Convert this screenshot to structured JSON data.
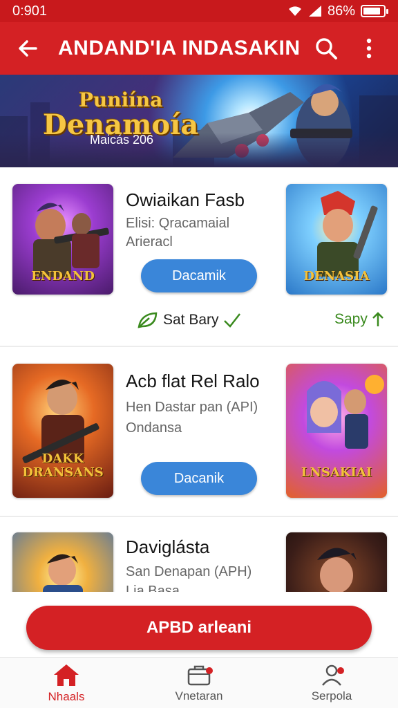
{
  "status_bar": {
    "time": "0:901",
    "battery": "86%",
    "battery_level": 0.86
  },
  "app_bar": {
    "title": "ANDAND'IA INDASAKIN",
    "back_icon": "arrow-left-icon",
    "search_icon": "search-icon",
    "more_icon": "more-vertical-icon"
  },
  "banner": {
    "title_top": "Puniína",
    "title_main": "Denamoía",
    "subtitle": "Maicás 206"
  },
  "games": [
    {
      "title": "Owiaikan Fasb",
      "line1": "Elisi: Qracamaial",
      "line2": "Arieracl",
      "button": "Dacamik",
      "left_caption": "ENDAND",
      "right_caption": "DENASIA"
    },
    {
      "title": "Acb flat Rel Ralo",
      "line1": "Hen Dastar pan (API)",
      "line2": "Ondansa",
      "button": "Dacanik",
      "left_caption": "DAKK DRANSANS",
      "right_caption": "LNSAKIAI"
    },
    {
      "title": "Daviglásta",
      "line1": "San Denapan (APH)",
      "line2": "Lia Basa",
      "left_caption": "",
      "right_caption": ""
    }
  ],
  "tags": {
    "left": "Sat Bary",
    "right": "Sapy"
  },
  "cta": {
    "label": "APBD arleani"
  },
  "bottom_nav": [
    {
      "label": "Nhaals",
      "icon": "home-icon",
      "active": true
    },
    {
      "label": "Vnetaran",
      "icon": "briefcase-icon",
      "active": false
    },
    {
      "label": "Serpola",
      "icon": "profile-icon",
      "active": false
    }
  ],
  "colors": {
    "primary": "#d42124",
    "status": "#c8191c",
    "button_blue": "#3a86d9",
    "tag_green": "#3a8a1e"
  }
}
